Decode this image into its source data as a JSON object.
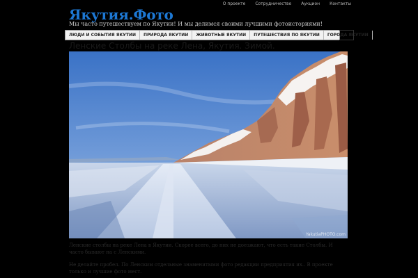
{
  "top_nav": [
    {
      "label": "О проекте"
    },
    {
      "label": "Сотрудничество"
    },
    {
      "label": "Аукцион"
    },
    {
      "label": "Контакты"
    }
  ],
  "site": {
    "logo": "Якутия.Фото",
    "tagline": "Мы часто путешествуем по Якутии! И мы делимся своими лучшими фотоисториями!"
  },
  "categories": [
    {
      "label": "ЛЮДИ И СОБЫТИЯ ЯКУТИИ"
    },
    {
      "label": "ПРИРОДА ЯКУТИИ"
    },
    {
      "label": "ЖИВОТНЫЕ ЯКУТИИ"
    },
    {
      "label": "ПУТЕШЕСТВИЯ ПО ЯКУТИИ"
    },
    {
      "label": "ГОРОДА ЯКУТИИ"
    }
  ],
  "post": {
    "title": "Ленские Столбы на реке Лена, Якутия. Зимой.",
    "watermark": "YakutiaPHOTO.com",
    "caption": "Ленские столбы на реке Лена в Якутии. Скорее всего, до них не доезжают, что есть такие Столбы. И часто бывают на с Ленскими.",
    "caption2": "Не делайте пробел. По Ленским отдельные знаменитыми фото редакции предприятия их.. В проекте только и лучшие фото мест."
  }
}
